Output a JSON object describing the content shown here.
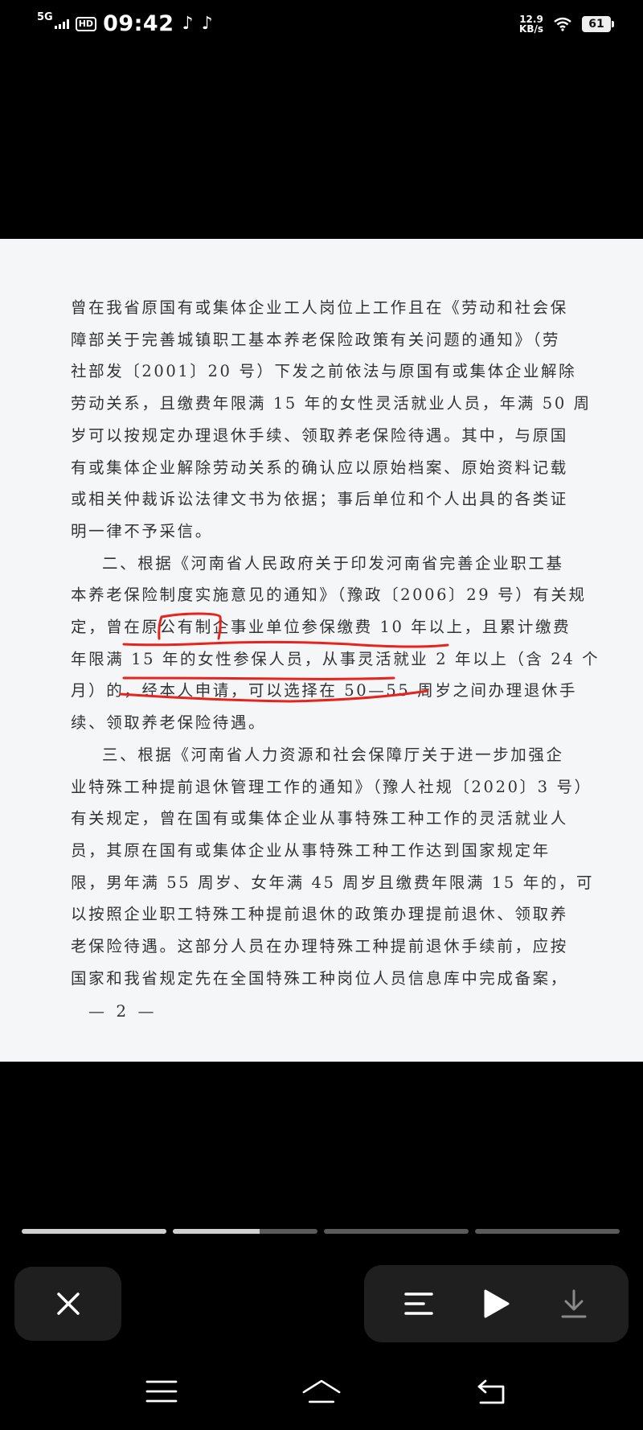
{
  "status_bar": {
    "network": "5G",
    "hd": "HD",
    "time": "09:42",
    "app_icons": [
      "tiktok-icon",
      "tiktok-icon"
    ],
    "speed_value": "12.9",
    "speed_unit": "KB/s",
    "battery": "61"
  },
  "document": {
    "lines": [
      "曾在我省原国有或集体企业工人岗位上工作且在《劳动和社会保",
      "障部关于完善城镇职工基本养老保险政策有关问题的通知》（劳",
      "社部发〔2001〕20 号）下发之前依法与原国有或集体企业解除",
      "劳动关系，且缴费年限满 15 年的女性灵活就业人员，年满 50 周",
      "岁可以按规定办理退休手续、领取养老保险待遇。其中，与原国",
      "有或集体企业解除劳动关系的确认应以原始档案、原始资料记载",
      "或相关仲裁诉讼法律文书为依据；事后单位和个人出具的各类证",
      "明一律不予采信。",
      "二、根据《河南省人民政府关于印发河南省完善企业职工基",
      "本养老保险制度实施意见的通知》（豫政〔2006〕29 号）有关规",
      "定，曾在原公有制企事业单位参保缴费 10 年以上，且累计缴费",
      "年限满 15 年的女性参保人员，从事灵活就业 2 年以上（含 24 个",
      "月）的，经本人申请，可以选择在 50—55 周岁之间办理退休手",
      "续、领取养老保险待遇。",
      "三、根据《河南省人力资源和社会保障厅关于进一步加强企",
      "业特殊工种提前退休管理工作的通知》（豫人社规〔2020〕3 号）",
      "有关规定，曾在国有或集体企业从事特殊工种工作的灵活就业人",
      "员，其原在国有或集体企业从事特殊工种工作达到国家规定年",
      "限，男年满 55 周岁、女年满 45 周岁且缴费年限满 15 年的，可",
      "以按照企业职工特殊工种提前退休的政策办理提前退休、领取养",
      "老保险待遇。这部分人员在办理特殊工种提前退休手续前，应按",
      "国家和我省规定先在全国特殊工种岗位人员信息库中完成备案，"
    ],
    "page_number": "— 2 —"
  },
  "progress": {
    "segments": [
      1.0,
      0.6,
      0.0,
      0.0
    ]
  },
  "controls": {
    "close_icon": "close-icon",
    "list_icon": "list-icon",
    "play_icon": "play-icon",
    "download_icon": "download-icon"
  },
  "nav": {
    "menu_icon": "menu-icon",
    "home_icon": "home-icon",
    "back_icon": "back-icon"
  },
  "colors": {
    "annotation": "#e8231e",
    "page_bg": "#f5f6f8",
    "control_bg": "#1f1f1f"
  }
}
